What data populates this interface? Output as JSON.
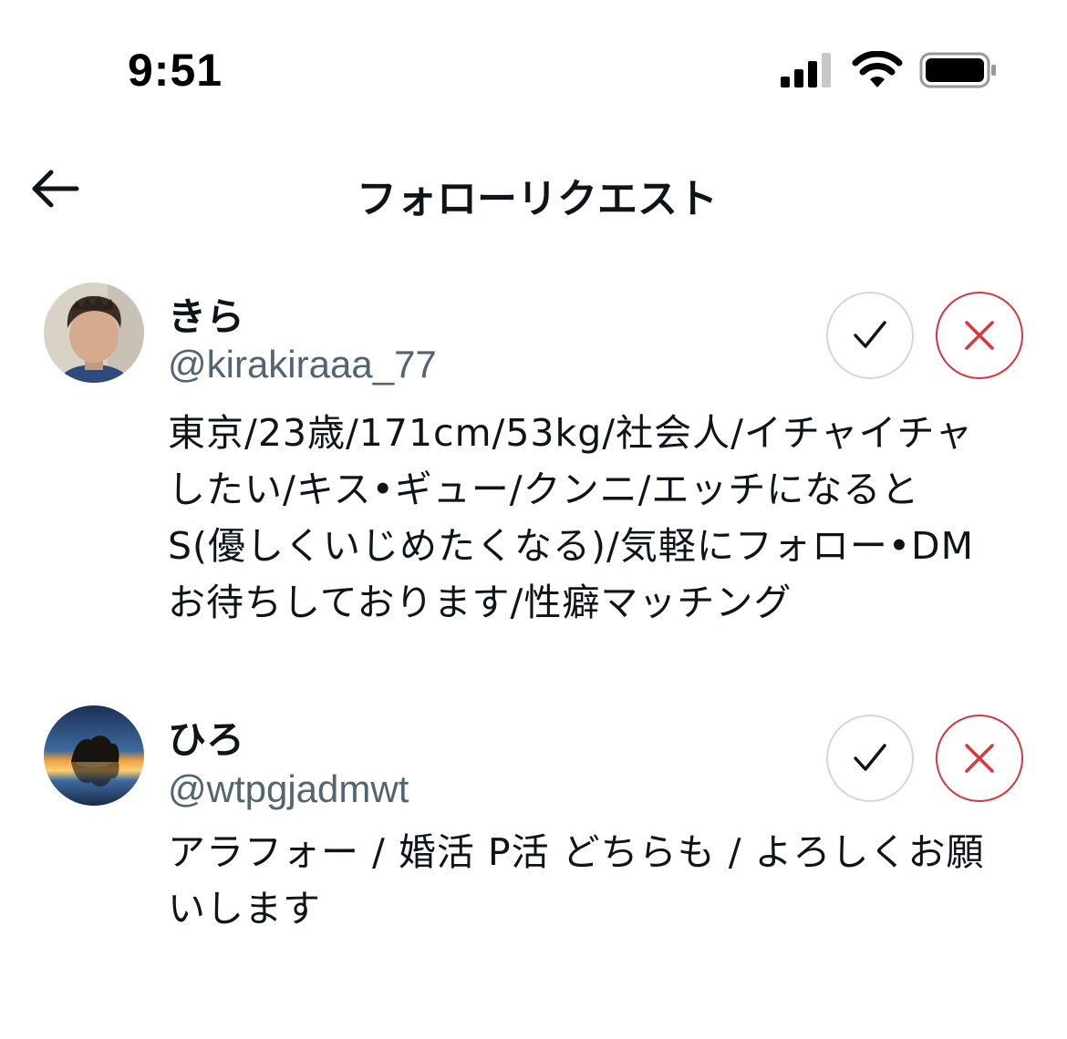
{
  "status_bar": {
    "time": "9:51",
    "icons": [
      "signal-icon",
      "wifi-icon",
      "battery-icon"
    ]
  },
  "header": {
    "back_icon": "arrow-left-icon",
    "title": "フォローリクエスト"
  },
  "requests": [
    {
      "display_name": "きら",
      "handle": "@kirakiraaa_77",
      "bio": "東京/23歳/171cm/53kg/社会人/イチャイチャしたい/キス•ギュー/クンニ/エッチになるとS(優しくいじめたくなる)/気軽にフォロー•DMお待ちしております/性癖マッチング",
      "avatar": "avatar-man-photo",
      "accept_icon": "check-icon",
      "decline_icon": "x-icon"
    },
    {
      "display_name": "ひろ",
      "handle": "@wtpgjadmwt",
      "bio": "アラフォー / 婚活 P活 どちらも / よろしくお願いします",
      "avatar": "avatar-sunset-photo",
      "accept_icon": "check-icon",
      "decline_icon": "x-icon"
    }
  ],
  "colors": {
    "text_primary": "#0f1419",
    "text_secondary": "#536471",
    "accept_border": "#cfd9de",
    "decline_red": "#d9363e"
  }
}
